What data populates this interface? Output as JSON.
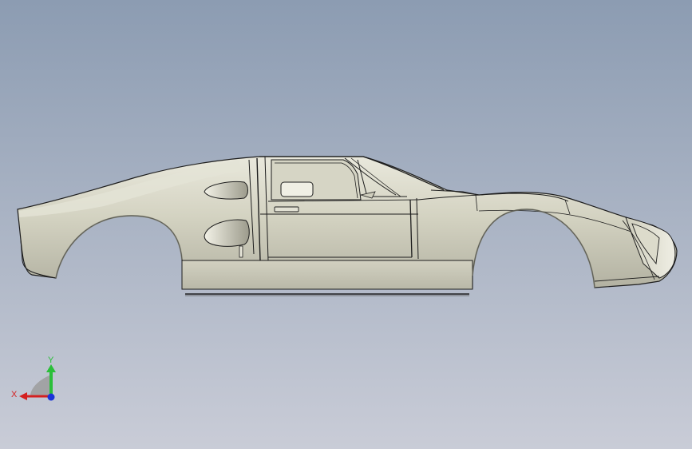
{
  "viewport": {
    "background_top": "#8c9cb2",
    "background_bottom": "#c9ccd7"
  },
  "model": {
    "body_color": "#d6d6c4",
    "shade_color": "#a8a898",
    "highlight_color": "#ecebe0",
    "edge_color": "#1d1d1d"
  },
  "triad": {
    "x_label": "X",
    "y_label": "Y",
    "x_color": "#d42020",
    "y_color": "#2bbf3a",
    "z_color": "#1b34d8"
  }
}
